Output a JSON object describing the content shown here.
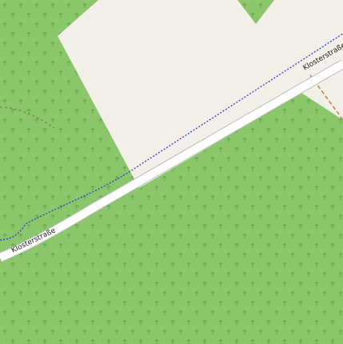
{
  "map": {
    "colors": {
      "forest": "#8cc66b",
      "forest_symbol": "#5aa84f",
      "landuse_area": "#f2efe9",
      "road_fill": "#ffffff",
      "road_casing": "#bdbdbd",
      "boundary_line": "#2d3fd6",
      "track_line": "#b5863a",
      "path_line": "#7a6b5a"
    },
    "roads": [
      {
        "name": "Klosterstraße"
      }
    ],
    "labels": {
      "road_label_1": "Klosterstraße",
      "road_label_2": "Klosterstraße"
    }
  }
}
